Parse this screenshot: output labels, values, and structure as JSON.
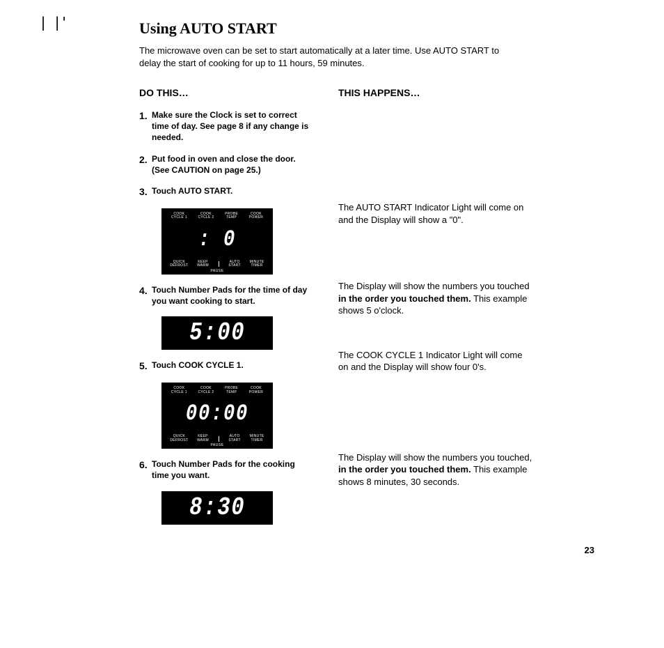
{
  "title": "Using AUTO START",
  "intro": "The microwave oven can be set to start automatically at a later time. Use AUTO START to delay the start of cooking for up to 11 hours, 59 minutes.",
  "headers": {
    "left": "DO THIS…",
    "right": "THIS HAPPENS…"
  },
  "steps": {
    "s1": {
      "num": "1.",
      "text": "Make sure the Clock is set to correct time of day. See page 8 if any change is needed."
    },
    "s2": {
      "num": "2.",
      "text": "Put food in oven and close the door. (See CAUTION on page 25.)"
    },
    "s3": {
      "num": "3.",
      "text": "Touch AUTO START."
    },
    "s4": {
      "num": "4.",
      "text": "Touch Number Pads for the time of day you want cooking to start."
    },
    "s5": {
      "num": "5.",
      "text": "Touch COOK CYCLE 1."
    },
    "s6": {
      "num": "6.",
      "text": "Touch Number Pads for the cooking time you want."
    }
  },
  "explain": {
    "e3": {
      "t1": "The AUTO START Indicator Light will come on and the Display will show a \"0\"."
    },
    "e4": {
      "t1": "The Display will show the numbers you touched ",
      "b": "in the order you touched them.",
      "t2": " This example shows 5 o'clock."
    },
    "e5": {
      "t1": "The COOK CYCLE 1 Indicator Light will come on and the Display will show four 0's."
    },
    "e6": {
      "t1": "The Display will show the numbers you touched, ",
      "b": "in the order you touched them.",
      "t2": " This example shows 8 minutes, 30 seconds."
    }
  },
  "panels": {
    "labels": {
      "top": {
        "c1": "COOK\nCYCLE 1",
        "c2": "COOK\nCYCLE 2",
        "c3": "PROBE\nTEMP",
        "c4": "COOK\nPOWER"
      },
      "bot": {
        "c1": "QUICK\nDEFROST",
        "c2": "KEEP\nWARM",
        "c3": "AUTO\nSTART",
        "c4": "MINUTE\nTIMER"
      },
      "pause": "PAUSE"
    },
    "display": {
      "p3": ":  0",
      "p4": "5:00",
      "p5": "00:00",
      "p6": "8:30"
    }
  },
  "page_number": "23"
}
